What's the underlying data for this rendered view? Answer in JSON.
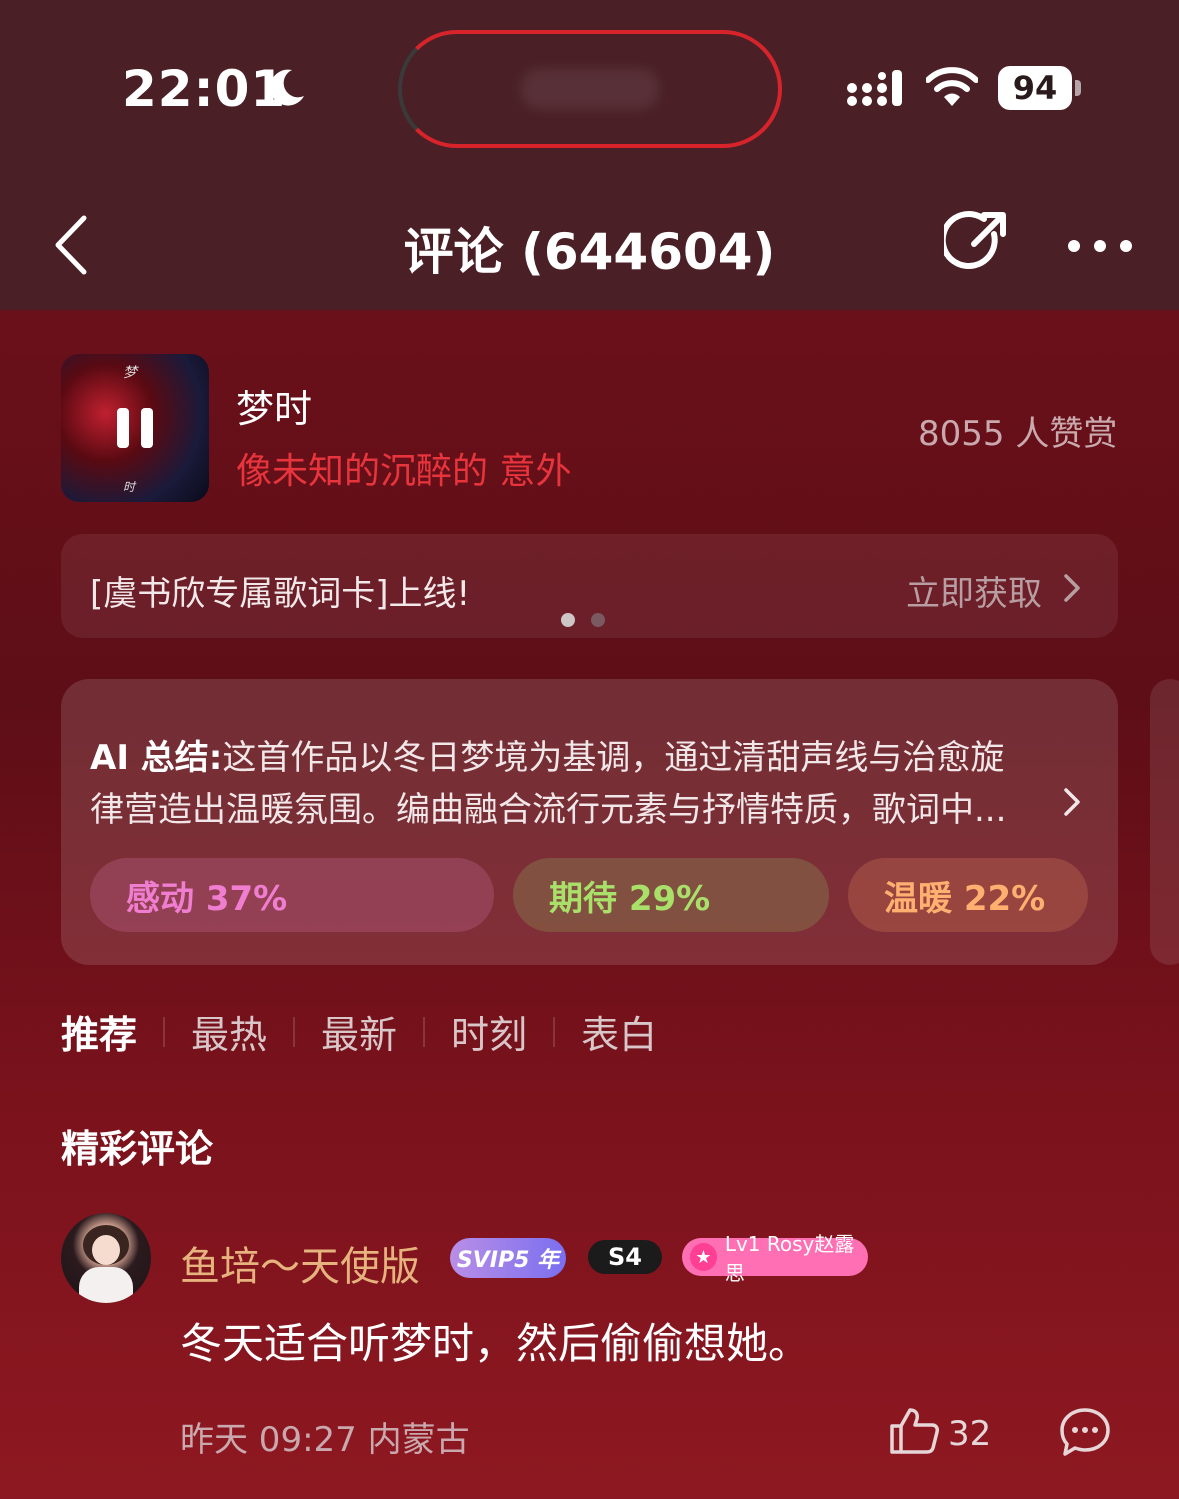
{
  "status_bar": {
    "time": "22:01",
    "battery": "94"
  },
  "header": {
    "title": "评论 (644604)"
  },
  "song": {
    "title": "梦时",
    "lyric": "像未知的沉醉的 意外",
    "appreciation": "8055 人赞赏",
    "cover_top_glyph": "梦",
    "cover_bottom_glyph": "时"
  },
  "banner": {
    "text": "[虞书欣专属歌词卡]上线!",
    "link": "立即获取"
  },
  "ai_summary": {
    "label": "AI 总结:",
    "line1": "这首作品以冬日梦境为基调，通过清甜声线与治愈旋",
    "line2": "律营造出温暖氛围。编曲融合流行元素与抒情特质，歌词中...",
    "tags": [
      {
        "label": "感动 37%"
      },
      {
        "label": "期待 29%"
      },
      {
        "label": "温暖 22%"
      }
    ]
  },
  "tabs": [
    "推荐",
    "最热",
    "最新",
    "时刻",
    "表白"
  ],
  "section_title": "精彩评论",
  "comment": {
    "username": "鱼培～天使版",
    "svip_badge": "SVIP5 年",
    "level_badge": "S4",
    "fan_badge": "Lv1 Rosy赵露思",
    "text": "冬天适合听梦时，然后偷偷想她。",
    "meta": "昨天 09:27 内蒙古",
    "likes": "32"
  },
  "colors": {
    "lyric_red": "#e8343c",
    "username_gold": "#e6b27e",
    "tag_moved": "#f07ed0",
    "tag_expect": "#a9e06a",
    "tag_warm": "#ffb070"
  }
}
